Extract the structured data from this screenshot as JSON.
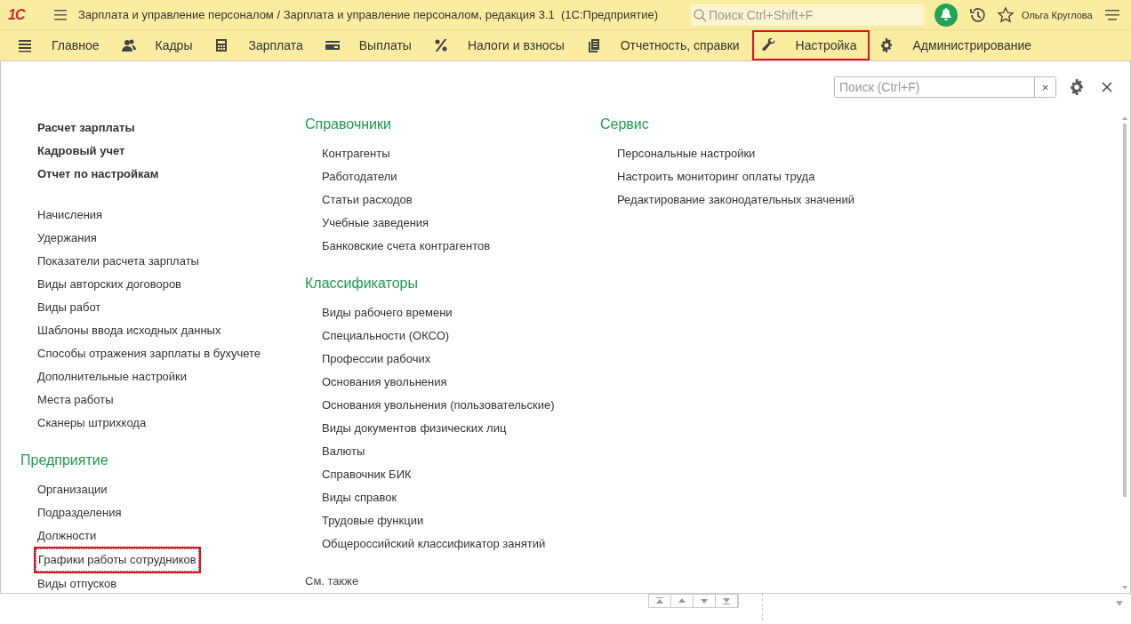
{
  "header": {
    "logo": "1С",
    "title": "Зарплата и управление персоналом / Зарплата и управление персоналом, редакция 3.1  (1С:Предприятие)",
    "search": {
      "placeholder": "Поиск Ctrl+Shift+F"
    },
    "user": "Ольга Круглова"
  },
  "sections": [
    {
      "label": "Главное",
      "selected": false
    },
    {
      "label": "Кадры",
      "selected": false
    },
    {
      "label": "Зарплата",
      "selected": false
    },
    {
      "label": "Выплаты",
      "selected": false
    },
    {
      "label": "Налоги и взносы",
      "selected": false
    },
    {
      "label": "Отчетность, справки",
      "selected": false
    },
    {
      "label": "Настройка",
      "selected": true
    },
    {
      "label": "Администрирование",
      "selected": false
    }
  ],
  "panel_search": {
    "placeholder": "Поиск (Ctrl+F)",
    "clear": "×"
  },
  "columns": [
    [
      {
        "kind": "featured",
        "links": [
          {
            "text": "Расчет зарплаты",
            "highlighted": false
          },
          {
            "text": "Кадровый учет",
            "highlighted": false
          },
          {
            "text": "Отчет по настройкам",
            "highlighted": false
          }
        ]
      },
      {
        "kind": "plain",
        "links": [
          {
            "text": "Начисления",
            "highlighted": false
          },
          {
            "text": "Удержания",
            "highlighted": false
          },
          {
            "text": "Показатели расчета зарплаты",
            "highlighted": false
          },
          {
            "text": "Виды авторских договоров",
            "highlighted": false
          },
          {
            "text": "Виды работ",
            "highlighted": false
          },
          {
            "text": "Шаблоны ввода исходных данных",
            "highlighted": false
          },
          {
            "text": "Способы отражения зарплаты в бухучете",
            "highlighted": false
          },
          {
            "text": "Дополнительные настройки",
            "highlighted": false
          },
          {
            "text": "Места работы",
            "highlighted": false
          },
          {
            "text": "Сканеры штрихкода",
            "highlighted": false
          }
        ]
      },
      {
        "kind": "group",
        "title": "Предприятие",
        "links": [
          {
            "text": "Организации",
            "highlighted": false
          },
          {
            "text": "Подразделения",
            "highlighted": false
          },
          {
            "text": "Должности",
            "highlighted": false
          },
          {
            "text": "Графики работы сотрудников",
            "highlighted": true
          },
          {
            "text": "Виды отпусков",
            "highlighted": false
          }
        ]
      }
    ],
    [
      {
        "kind": "group",
        "title": "Справочники",
        "links": [
          {
            "text": "Контрагенты",
            "highlighted": false
          },
          {
            "text": "Работодатели",
            "highlighted": false
          },
          {
            "text": "Статьи расходов",
            "highlighted": false
          },
          {
            "text": "Учебные заведения",
            "highlighted": false
          },
          {
            "text": "Банковские счета контрагентов",
            "highlighted": false
          }
        ]
      },
      {
        "kind": "group",
        "title": "Классификаторы",
        "links": [
          {
            "text": "Виды рабочего времени",
            "highlighted": false
          },
          {
            "text": "Специальности (ОКСО)",
            "highlighted": false
          },
          {
            "text": "Профессии рабочих",
            "highlighted": false
          },
          {
            "text": "Основания увольнения",
            "highlighted": false
          },
          {
            "text": "Основания увольнения (пользовательские)",
            "highlighted": false
          },
          {
            "text": "Виды документов физических лиц",
            "highlighted": false
          },
          {
            "text": "Валюты",
            "highlighted": false
          },
          {
            "text": "Справочник БИК",
            "highlighted": false
          },
          {
            "text": "Виды справок",
            "highlighted": false
          },
          {
            "text": "Трудовые функции",
            "highlighted": false
          },
          {
            "text": "Общероссийский классификатор занятий",
            "highlighted": false
          }
        ]
      },
      {
        "kind": "footer",
        "title": "См. также"
      }
    ],
    [
      {
        "kind": "group",
        "title": "Сервис",
        "links": [
          {
            "text": "Персональные настройки",
            "highlighted": false
          },
          {
            "text": "Настроить мониторинг оплаты труда",
            "highlighted": false
          },
          {
            "text": "Редактирование законодательных значений",
            "highlighted": false
          }
        ]
      }
    ]
  ]
}
